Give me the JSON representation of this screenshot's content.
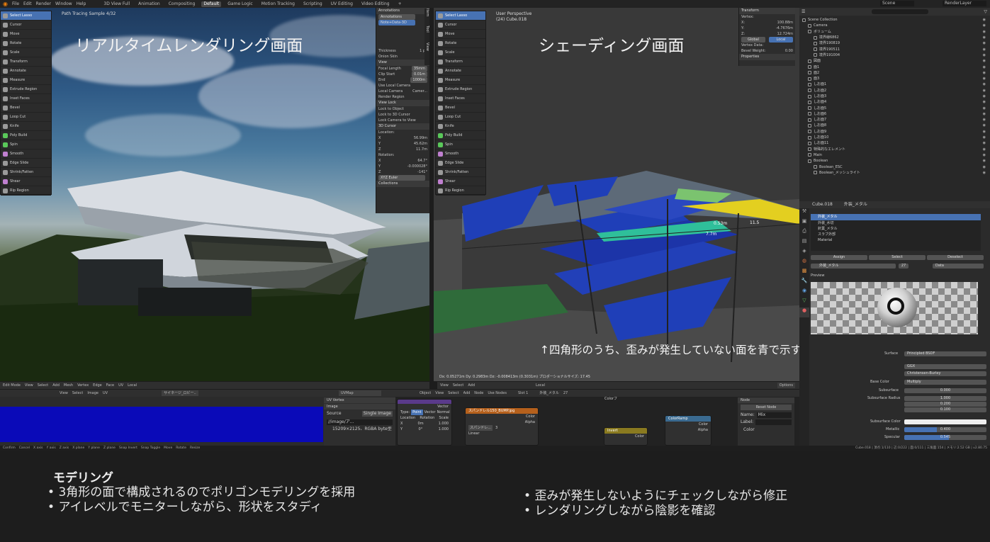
{
  "topbar": {
    "menus": [
      "File",
      "Edit",
      "Render",
      "Window",
      "Help"
    ],
    "workspaces": [
      "3D View Full",
      "Animation",
      "Compositing",
      "Default",
      "Game Logic",
      "Motion Tracking",
      "Scripting",
      "UV Editing",
      "Video Editing",
      "+"
    ],
    "active_workspace": "Default",
    "scene": "Scene",
    "render_layer": "RenderLayer"
  },
  "left_viewport": {
    "overlay_text": "Path Tracing Sample 4/32",
    "title": "リアルタイムレンダリング画面",
    "tools": [
      "Select Lasso",
      "Cursor",
      "Move",
      "Rotate",
      "Scale",
      "Transform",
      "Annotate",
      "Measure",
      "Extrude Region",
      "Inset Faces",
      "Bevel",
      "Loop Cut",
      "Knife",
      "Poly Build",
      "Spin",
      "Smooth",
      "Edge Slide",
      "Shrink/Fatten",
      "Shear",
      "Rip Region"
    ],
    "header": [
      "Edit Mode",
      "View",
      "Select",
      "Add",
      "Mesh",
      "Vertex",
      "Edge",
      "Face",
      "UV",
      "Local"
    ]
  },
  "npanel_left": {
    "annotations_header": "Annotations",
    "annotations_layer": "Annotations",
    "note_field": "Note+Data-3D",
    "thickness_label": "Thickness",
    "thickness_value": "1 px",
    "onion_skin": "Onion Skin",
    "view_header": "View",
    "focal_length_label": "Focal Length",
    "focal_length_value": "35mm",
    "clip_start_label": "Clip Start",
    "clip_start_value": "0.01m",
    "end_label": "End",
    "end_value": "1000m",
    "use_local_camera": "Use Local Camera",
    "local_camera_label": "Local Camera",
    "local_camera_value": "Camer...",
    "render_region": "Render Region",
    "view_lock_header": "View Lock",
    "lock_to_object": "Lock to Object",
    "lock_to_cursor": "Lock to 3D Cursor",
    "lock_camera": "Lock Camera to View",
    "cursor_header": "3D Cursor",
    "location_label": "Location:",
    "cursor_x": "56.99m",
    "cursor_y": "45.62m",
    "cursor_z": "11.7m",
    "rotation_label": "Rotation:",
    "rot_x": "64.7°",
    "rot_y": "-0.000028°",
    "rot_z": "-141°",
    "rotation_mode": "XYZ Euler",
    "collections_header": "Collections",
    "tabs": [
      "Item",
      "Tool",
      "View"
    ]
  },
  "right_viewport": {
    "perspective": "User Perspective",
    "object": "(24) Cube.018",
    "title": "シェーディング画面",
    "annotation": "↑四角形のうち、歪みが発生していない面を青で示す",
    "measure_1": "0.53m",
    "measure_2": "11.5",
    "measure_3": "7.7m",
    "status_line": "Dx: 0.05271m  Dy: 0.2983m  Dz: -0.008413m (0.3031m)  プロポーショナルサイズ: 17.45",
    "options": "Options",
    "local": "Local"
  },
  "npanel_right": {
    "transform_header": "Transform",
    "vertex_label": "Vertex:",
    "x_label": "X:",
    "x_value": "100.88m",
    "y_label": "Y:",
    "y_value": "-4.7676m",
    "z_label": "Z:",
    "z_value": "12.724m",
    "global": "Global",
    "local": "Local",
    "vertex_data": "Vertex Data:",
    "bevel_weight_label": "Bevel Weight:",
    "bevel_weight_value": "0.00",
    "properties_header": "Properties"
  },
  "outliner": {
    "search": "",
    "items": [
      {
        "name": "Scene Collection",
        "indent": 0
      },
      {
        "name": "Camera",
        "indent": 1
      },
      {
        "name": "ボリューム",
        "indent": 1
      },
      {
        "name": "境界線6862",
        "indent": 2
      },
      {
        "name": "境界190819",
        "indent": 2
      },
      {
        "name": "境界190511",
        "indent": 2
      },
      {
        "name": "境界191004",
        "indent": 2
      },
      {
        "name": "図面",
        "indent": 1
      },
      {
        "name": "面1",
        "indent": 1
      },
      {
        "name": "面2",
        "indent": 1
      },
      {
        "name": "面3",
        "indent": 1
      },
      {
        "name": "しお面1",
        "indent": 1
      },
      {
        "name": "しお面2",
        "indent": 1
      },
      {
        "name": "しお面3",
        "indent": 1
      },
      {
        "name": "しお面4",
        "indent": 1
      },
      {
        "name": "しお面5",
        "indent": 1
      },
      {
        "name": "しお面6",
        "indent": 1
      },
      {
        "name": "しお面7",
        "indent": 1
      },
      {
        "name": "しお面8",
        "indent": 1
      },
      {
        "name": "しお面9",
        "indent": 1
      },
      {
        "name": "しお面10",
        "indent": 1
      },
      {
        "name": "しお面11",
        "indent": 1
      },
      {
        "name": "特殊的なエレメント",
        "indent": 1
      },
      {
        "name": "Main",
        "indent": 1
      },
      {
        "name": "Boolean",
        "indent": 1
      },
      {
        "name": "Boolean_ESC",
        "indent": 2
      },
      {
        "name": "Boolean_メッシュライト",
        "indent": 2
      }
    ]
  },
  "properties": {
    "object": "Cube.018",
    "material_name": "外装_メタル",
    "slots": [
      "外装_メタル",
      "外装_水切",
      "針葉_メタル",
      "スラブ外部",
      "Material"
    ],
    "assign": "Assign",
    "select": "Select",
    "deselect": "Deselect",
    "material_field": "外装_メタル",
    "users": "27",
    "data_label": "Data",
    "preview_header": "Preview",
    "surface_label": "Surface",
    "surface_value": "Principled BSDF",
    "ggx": "GGX",
    "christensen": "Christensen-Burley",
    "base_color_label": "Base Color",
    "base_color_value": "Multiply",
    "subsurface_label": "Subsurface",
    "subsurface_value": "0.000",
    "radius_label": "Subsurface Radius",
    "radius_1": "1.000",
    "radius_2": "0.200",
    "radius_3": "0.100",
    "subsurface_color_label": "Subsurface Color",
    "metallic_label": "Metallic",
    "metallic_value": "0.400",
    "metallic_fraction": 0.4,
    "specular_label": "Specular",
    "specular_value": "0.545",
    "specular_fraction": 0.545
  },
  "uv_editor": {
    "header": [
      "View",
      "Select",
      "Image",
      "UV"
    ],
    "image_name": "サイネージ_ロビー..",
    "uvmap": "UVMap",
    "uv_vertex": "UV Vertex",
    "image_header": "Image",
    "source_label": "Source",
    "source_value": "Single Image",
    "path": "//image/ア...",
    "resolution": "15209×2125、RGBA byte型"
  },
  "node_editor": {
    "header": [
      "Object",
      "View",
      "Select",
      "Add",
      "Node",
      "Use Nodes"
    ],
    "slot": "Slot 1",
    "material": "外装_メタル",
    "count": "27",
    "vector_node": "Vector",
    "point_label": "Point",
    "vector_label": "Vector",
    "normal_label": "Normal",
    "type_label": "Type:",
    "location_label": "Location",
    "rotation_label": "Rotation",
    "scale_label": "Scale",
    "x_label": "X",
    "x_value": "0m",
    "scale_value": "1.000",
    "y_label": "Y",
    "y_value": "0°",
    "y_scale": "1.000",
    "image_node": "スパンドレル150_BUMP.jpg",
    "color_label": "Color",
    "alpha_label": "Alpha",
    "image_field": "スパンドレ...",
    "image_users": "3",
    "linear": "Linear",
    "invert_node": "Invert",
    "colorramp_node": "ColorRamp",
    "node_panel_header": "Node",
    "reset_node": "Reset Node",
    "name_label": "Name:",
    "name_value": "Mix",
    "label_label": "Label:",
    "color_panel": "Color",
    "rgb_label": "RGB",
    "linear2": "Linear",
    "colorramp_color": "Color",
    "colorramp_alpha": "Alpha",
    "invert_color": "Color",
    "mix_partial": "Colorフ"
  },
  "statusbar": {
    "items": [
      "Confirm",
      "Cancel",
      "X axis",
      "Y axis",
      "Z axis",
      "X plane",
      "Y plane",
      "Z plane",
      "Snap Invert",
      "Snap Toggle",
      "Move",
      "Rotate",
      "Resize"
    ],
    "right": "Cube.018 | 頂点:1/110 | 辺:0/222 | 面:0/111 | 三角面:154 | メモリ:2.52 GB | v2.80.75"
  },
  "notes": {
    "heading": "モデリング",
    "left": [
      "3角形の面で構成されるのでポリゴンモデリングを採用",
      "アイレベルでモニターしながら、形状をスタディ"
    ],
    "right": [
      "歪みが発生しないようにチェックしながら修正",
      "レンダリングしながら陰影を確認"
    ]
  }
}
